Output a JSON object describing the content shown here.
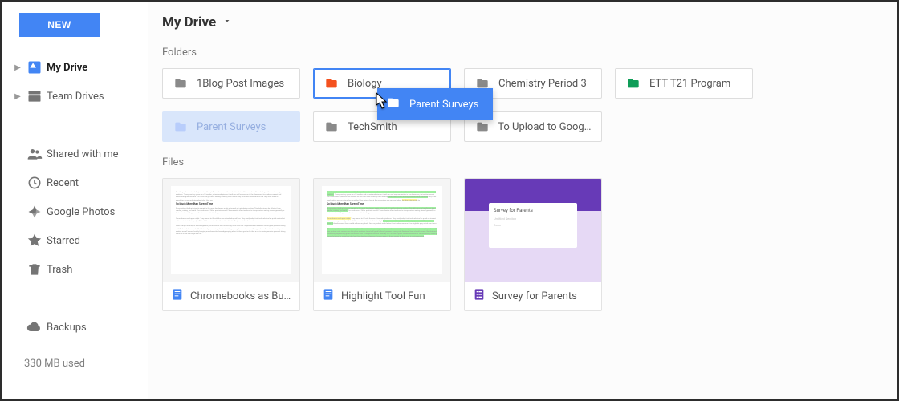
{
  "sidebar": {
    "new_label": "NEW",
    "items": [
      {
        "label": "My Drive"
      },
      {
        "label": "Team Drives"
      },
      {
        "label": "Shared with me"
      },
      {
        "label": "Recent"
      },
      {
        "label": "Google Photos"
      },
      {
        "label": "Starred"
      },
      {
        "label": "Trash"
      },
      {
        "label": "Backups"
      }
    ],
    "storage": "330 MB used"
  },
  "header": {
    "title": "My Drive"
  },
  "sections": {
    "folders_label": "Folders",
    "files_label": "Files"
  },
  "folders": [
    {
      "name": "1Blog Post Images",
      "color": "#8a8a8a"
    },
    {
      "name": "Biology",
      "color": "#f4511e",
      "selected": true
    },
    {
      "name": "Chemistry Period 3",
      "color": "#8a8a8a"
    },
    {
      "name": "ETT T21 Program",
      "color": "#0f9d58"
    },
    {
      "name": "Parent Surveys",
      "color": "#b8cdfb",
      "ghost": true
    },
    {
      "name": "TechSmith",
      "color": "#8a8a8a"
    },
    {
      "name": "To Upload to Googl...",
      "color": "#8a8a8a"
    }
  ],
  "files": [
    {
      "name": "Chromebooks as Buildi...",
      "kind": "docs-plain"
    },
    {
      "name": "Highlight Tool Fun",
      "kind": "docs-hl"
    },
    {
      "name": "Survey for Parents",
      "kind": "forms"
    }
  ],
  "forms_thumb": {
    "title": "Survey for Parents",
    "sub1": "Untitled Section",
    "sub2": "Done"
  },
  "drag": {
    "label": "Parent Surveys"
  },
  "colors": {
    "primary": "#4285f4",
    "docs": "#4285f4",
    "forms": "#673ab7"
  }
}
